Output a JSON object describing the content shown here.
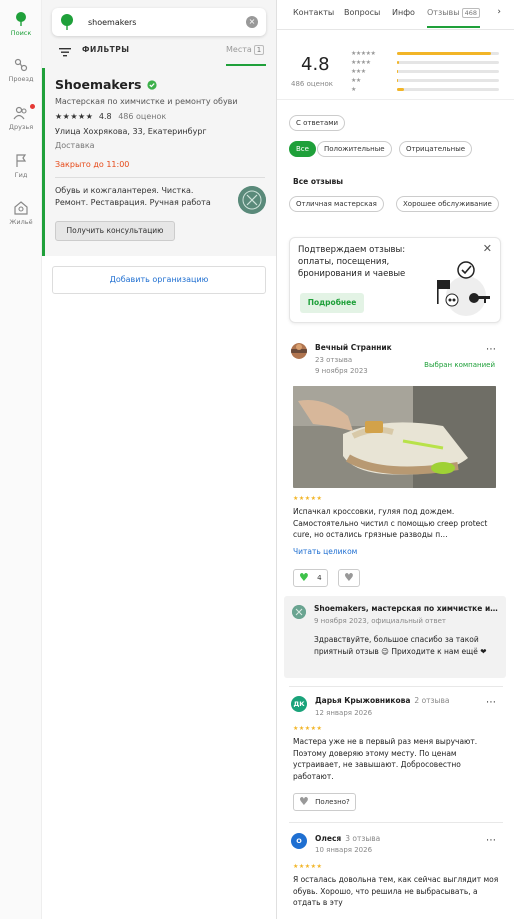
{
  "rail": {
    "items": [
      {
        "label": "Поиск",
        "icon": "search-leaf-icon"
      },
      {
        "label": "Проезд",
        "icon": "route-icon"
      },
      {
        "label": "Друзья",
        "icon": "friends-icon"
      },
      {
        "label": "Гид",
        "icon": "guide-flag-icon"
      },
      {
        "label": "Жильё",
        "icon": "housing-icon"
      }
    ]
  },
  "search": {
    "value": "shoemakers"
  },
  "filters": {
    "label": "ФИЛЬТРЫ",
    "places_label": "Места",
    "places_count": "1"
  },
  "org": {
    "name": "Shoemakers",
    "description": "Мастерская по химчистке и ремонту обуви",
    "stars": "★★★★★",
    "rating": "4.8",
    "reviews_count": "486 оценок",
    "address": "Улица Хохрякова, 33, Екатеринбург",
    "delivery": "Доставка",
    "hours": "Закрыто до 11:00",
    "categories": "Обувь и кожгалантерея. Чистка. Ремонт. Реставрация. Ручная работа",
    "consult_button": "Получить консультацию"
  },
  "add_org": "Добавить организацию",
  "tabs": [
    {
      "label": "Контакты"
    },
    {
      "label": "Вопросы"
    },
    {
      "label": "Инфо"
    },
    {
      "label": "Отзывы",
      "count": "468"
    }
  ],
  "rating_summary": {
    "value": "4.8",
    "count": "486 оценок",
    "distribution": [
      {
        "stars": "★★★★★",
        "fraction": 0.92
      },
      {
        "stars": "★★★★",
        "fraction": 0.02
      },
      {
        "stars": "★★★",
        "fraction": 0.01
      },
      {
        "stars": "★★",
        "fraction": 0.01
      },
      {
        "stars": "★",
        "fraction": 0.07
      }
    ]
  },
  "filter_chips": {
    "with_answers": "С ответами",
    "all": "Все",
    "positive": "Положительные",
    "negative": "Отрицательные"
  },
  "all_reviews_label": "Все отзывы",
  "tag_chips": {
    "t1": "Отличная мастерская",
    "t2": "Хорошее обслуживание"
  },
  "promo": {
    "text": "Подтверждаем отзывы: оплаты, посещения, бронирования и чаевые",
    "button": "Подробнее"
  },
  "reviews": [
    {
      "author": "Вечный Странник",
      "sub1": "23 отзыва",
      "date": "9 ноября 2023",
      "badge": "Выбран компанией",
      "stars": "★★★★★",
      "text": "Испачкал кроссовки, гуляя под дождем. Самостоятельно чистил с помощью creep protect cure, но остались грязные разводы п…",
      "read_more": "Читать целиком",
      "likes": "4",
      "reply": {
        "name": "Shoemakers, мастерская по химчистке и ремонту обуви",
        "sub": "9 ноября 2023, официальный ответ",
        "text": "Здравствуйте, большое спасибо за такой приятный отзыв 😉 Приходите к нам ещё ❤"
      }
    },
    {
      "author": "Дарья Крыжовникова",
      "initials": "ДК",
      "count": "2 отзыва",
      "date": "12 января 2026",
      "stars": "★★★★★",
      "text": "Мастера уже не в первый раз меня выручают. Поэтому доверяю этому месту. По ценам устраивает, не завышают. Добросовестно работают.",
      "helpful": "Полезно?"
    },
    {
      "author": "Олеся",
      "initials": "О",
      "count": "3 отзыва",
      "date": "10 января 2026",
      "stars": "★★★★★",
      "text": "Я осталась довольна тем, как сейчас выглядит моя обувь. Хорошо, что решила не выбрасывать, а отдать в эту"
    }
  ],
  "colors": {
    "accent": "#1fa03a",
    "link": "#1f6fd1",
    "star": "#f2b527",
    "closed": "#e64a19"
  }
}
